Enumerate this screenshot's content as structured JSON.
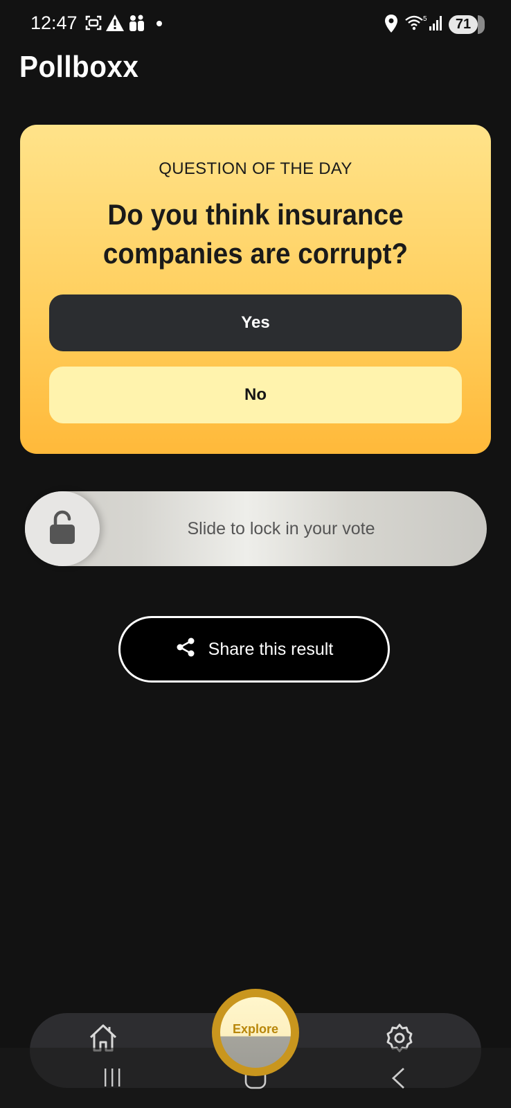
{
  "status_bar": {
    "time": "12:47",
    "battery": "71",
    "network": "5"
  },
  "app": {
    "title": "Pollboxx"
  },
  "question_card": {
    "label": "QUESTION OF THE DAY",
    "question": "Do you think insurance companies are corrupt?",
    "options": [
      {
        "label": "Yes",
        "selected": true
      },
      {
        "label": "No",
        "selected": false
      }
    ]
  },
  "lock_slider": {
    "text": "Slide to lock in your vote",
    "icon": "lock-open-icon"
  },
  "share": {
    "label": "Share this result",
    "icon": "share-icon"
  },
  "bottom_nav": {
    "home_icon": "home-icon",
    "explore_label": "Explore",
    "settings_icon": "gear-icon"
  },
  "colors": {
    "background": "#121212",
    "card_top": "#ffe38a",
    "card_bottom": "#ffb93a",
    "yes_bg": "#2b2d30",
    "no_bg": "#fff3ad",
    "explore_ring": "#c9961e"
  }
}
